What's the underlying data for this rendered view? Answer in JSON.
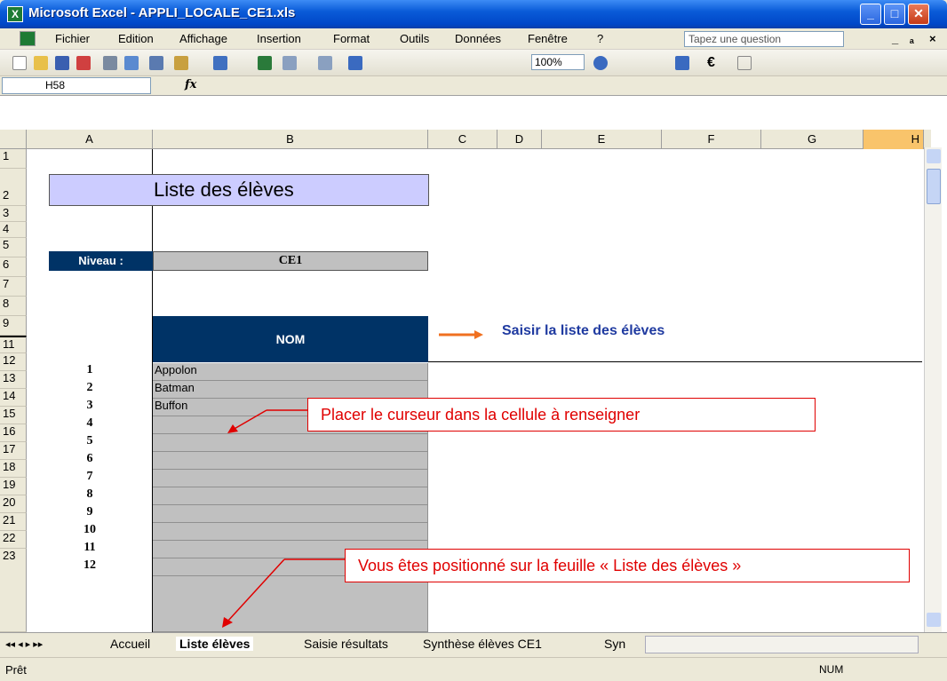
{
  "window": {
    "title": "Microsoft Excel - APPLI_LOCALE_CE1.xls"
  },
  "menu": [
    "Fichier",
    "Edition",
    "Affichage",
    "Insertion",
    "Format",
    "Outils",
    "Données",
    "Fenêtre",
    "?"
  ],
  "question_placeholder": "Tapez une question",
  "toolbar": {
    "zoom": "100%"
  },
  "formula": {
    "name_box": "H58",
    "fx": "fx"
  },
  "columns": [
    "A",
    "B",
    "C",
    "D",
    "E",
    "F",
    "G",
    "H"
  ],
  "rows": [
    "1",
    "2",
    "3",
    "4",
    "5",
    "6",
    "7",
    "8",
    "9",
    "11",
    "12",
    "13",
    "14",
    "15",
    "16",
    "17",
    "18",
    "19",
    "20",
    "21",
    "22",
    "23"
  ],
  "sheet": {
    "title": "Liste des élèves",
    "niveau_label": "Niveau :",
    "niveau_value": "CE1",
    "nom_header": "NOM",
    "instruction": "Saisir la liste des élèves",
    "students": [
      {
        "num": "1",
        "name": "Appolon"
      },
      {
        "num": "2",
        "name": "Batman"
      },
      {
        "num": "3",
        "name": "Buffon"
      },
      {
        "num": "4",
        "name": ""
      },
      {
        "num": "5",
        "name": ""
      },
      {
        "num": "6",
        "name": ""
      },
      {
        "num": "7",
        "name": ""
      },
      {
        "num": "8",
        "name": ""
      },
      {
        "num": "9",
        "name": ""
      },
      {
        "num": "10",
        "name": ""
      },
      {
        "num": "11",
        "name": ""
      },
      {
        "num": "12",
        "name": ""
      }
    ]
  },
  "callouts": {
    "cursor": "Placer le curseur dans la cellule à renseigner",
    "sheet": "Vous êtes positionné sur la feuille « Liste des élèves »"
  },
  "tabs": [
    "Accueil",
    "Liste élèves",
    "Saisie résultats",
    "Synthèse élèves CE1",
    "Syn"
  ],
  "status": {
    "left": "Prêt",
    "num": "NUM"
  }
}
